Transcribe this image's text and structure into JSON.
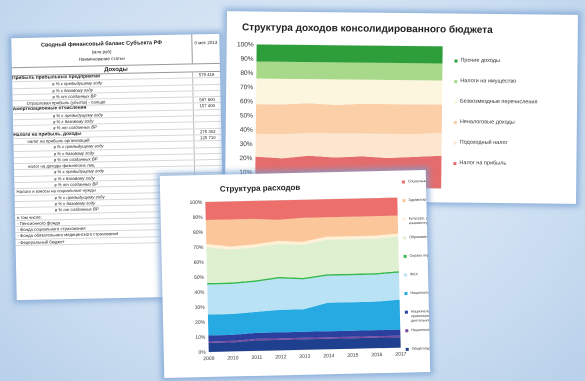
{
  "balance_sheet": {
    "title": "Сводный финансовый баланс Субъекта РФ",
    "unit": "(млн.руб)",
    "name_header": "Наименование статьи",
    "col_header": "0 мес 2013",
    "section": "Доходы",
    "rows": [
      {
        "label": "Прибыль прибыльных предприятий",
        "value": "579 418",
        "style": "b"
      },
      {
        "label": "в % к предыдущему году",
        "value": "",
        "style": "i2"
      },
      {
        "label": "в % к базовому году",
        "value": "",
        "style": "i2"
      },
      {
        "label": "в % от созданных ВР",
        "value": "",
        "style": "i2"
      },
      {
        "label": "Отраслевая прибыль (убыток) - сальдо",
        "value": "587 600",
        "style": "i1"
      },
      {
        "label": "Амортизационные отчисления",
        "value": "157 400",
        "style": "b"
      },
      {
        "label": "в % к предыдущему году",
        "value": "",
        "style": "i2"
      },
      {
        "label": "в % к базовому году",
        "value": "",
        "style": "i2"
      },
      {
        "label": "в % от созданных ВР",
        "value": "",
        "style": "i2"
      },
      {
        "label": "Налоги на прибыль, доходы",
        "value": "275 302",
        "style": "b"
      },
      {
        "label": "налог на прибыль организаций",
        "value": "125 710",
        "style": "i1"
      },
      {
        "label": "в % к предыдущему году",
        "value": "",
        "style": "i2"
      },
      {
        "label": "в % к базовому году",
        "value": "",
        "style": "i2"
      },
      {
        "label": "в % от созданных ВР",
        "value": "",
        "style": "i2"
      },
      {
        "label": "налог на доходы физических лиц",
        "value": "",
        "style": "i1"
      },
      {
        "label": "в % к предыдущему году",
        "value": "",
        "style": "i2"
      },
      {
        "label": "в % к базовому году",
        "value": "",
        "style": "i2"
      },
      {
        "label": "в % от созданных ВР",
        "value": "",
        "style": "i2"
      },
      {
        "label": "Налоги и взносы на социальные нужды",
        "value": "",
        "style": "i0"
      },
      {
        "label": "в % к предыдущему году",
        "value": "",
        "style": "i2"
      },
      {
        "label": "в % к базовому году",
        "value": "",
        "style": "i2"
      },
      {
        "label": "в % от созданных ВР",
        "value": "",
        "style": "i2"
      },
      {
        "label": "в том числе:",
        "value": "",
        "style": "i0"
      },
      {
        "label": "- Пенсионного фонда",
        "value": "",
        "style": "i0"
      },
      {
        "label": "- Фонда социального страхования",
        "value": "",
        "style": "i0"
      },
      {
        "label": "- Фонда обязательного медицинского страхования",
        "value": "",
        "style": "i0"
      },
      {
        "label": "- Федеральный бюджет",
        "value": "",
        "style": "i0"
      }
    ]
  },
  "chart_data": [
    {
      "type": "area",
      "title": "Структура доходов консолидированного бюджета",
      "ylim": [
        0,
        100
      ],
      "yticks": [
        "0%",
        "10%",
        "20%",
        "30%",
        "40%",
        "50%",
        "60%",
        "70%",
        "80%",
        "90%",
        "100%"
      ],
      "x_points": 8,
      "series": [
        {
          "name": "Налог на прибыль",
          "color": "#e46c6c",
          "values": [
            21,
            20,
            22,
            21,
            22,
            21,
            22,
            23
          ]
        },
        {
          "name": "Подоходный налог",
          "color": "#fde6cf",
          "values": [
            16,
            17,
            16,
            17,
            16,
            17,
            16,
            16
          ]
        },
        {
          "name": "Неналоговые доходы",
          "color": "#fbcfa8",
          "values": [
            21,
            21,
            21,
            20,
            21,
            21,
            21,
            20
          ]
        },
        {
          "name": "Безвозмездные перечисления",
          "color": "#fdf6df",
          "values": [
            18,
            18,
            17,
            18,
            17,
            17,
            17,
            17
          ]
        },
        {
          "name": "Налоги на имущество",
          "color": "#a8d98a",
          "values": [
            12,
            12,
            12,
            12,
            12,
            12,
            12,
            12
          ]
        },
        {
          "name": "Прочие доходы",
          "color": "#2e9e3a",
          "values": [
            12,
            12,
            12,
            12,
            12,
            12,
            12,
            12
          ]
        }
      ],
      "legend_position": "right"
    },
    {
      "type": "area",
      "title": "Структура расходов",
      "categories": [
        "2009",
        "2010",
        "2011",
        "2012",
        "2013",
        "2014",
        "2015",
        "2016",
        "2017"
      ],
      "ylim": [
        0,
        100
      ],
      "yticks": [
        "0%",
        "10%",
        "20%",
        "30%",
        "40%",
        "50%",
        "60%",
        "70%",
        "80%",
        "90%",
        "100%"
      ],
      "series": [
        {
          "name": "Общегосударственные вопросы",
          "color": "#1f3f8f",
          "values": [
            6,
            6,
            7,
            7,
            7,
            7,
            7,
            7,
            7
          ]
        },
        {
          "name": "Национальная оборона",
          "color": "#7a4aa0",
          "values": [
            1,
            1,
            1,
            1,
            1,
            1,
            1,
            1,
            1
          ]
        },
        {
          "name": "Национальная безопасность и правоохранительная деятельность",
          "color": "#2a3f9e",
          "values": [
            4,
            4,
            4,
            4,
            4,
            4,
            4,
            4,
            4
          ]
        },
        {
          "name": "Национальная экономика",
          "color": "#27a9e1",
          "values": [
            14,
            14,
            14,
            15,
            15,
            19,
            19,
            19,
            20
          ]
        },
        {
          "name": "ЖКХ",
          "color": "#b9e3f5",
          "values": [
            20,
            20,
            20,
            21,
            20,
            18,
            18,
            18,
            18
          ]
        },
        {
          "name": "Охрана окружающей среды",
          "color": "#36b84b",
          "values": [
            1,
            1,
            1,
            1,
            1,
            1,
            1,
            1,
            1
          ]
        },
        {
          "name": "Образование",
          "color": "#dff0d0",
          "values": [
            24,
            22,
            22,
            22,
            22,
            23,
            23,
            23,
            23
          ]
        },
        {
          "name": "Культура, искусство, кинематография, СМИ",
          "color": "#fff0d6",
          "values": [
            2,
            2,
            2,
            2,
            2,
            2,
            2,
            2,
            2
          ]
        },
        {
          "name": "Здравоохранение и физкультура",
          "color": "#fbc69a",
          "values": [
            16,
            18,
            17,
            14,
            16,
            13,
            13,
            13,
            12
          ]
        },
        {
          "name": "Социальные трансферты",
          "color": "#ec6f6b",
          "values": [
            12,
            12,
            12,
            13,
            12,
            12,
            12,
            12,
            12
          ]
        }
      ],
      "legend_position": "right"
    }
  ]
}
